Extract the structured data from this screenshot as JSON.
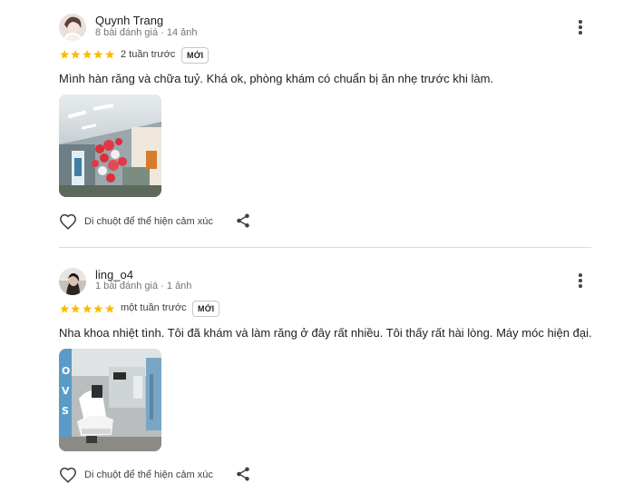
{
  "reviews": [
    {
      "name": "Quynh Trang",
      "meta": "8 bài đánh giá · 14 ảnh",
      "rating": 5,
      "time": "2 tuần trước",
      "badge": "MỚI",
      "text": "Mình hàn răng và chữa tuỷ. Khá ok, phòng khám có chuẩn bị ăn nhẹ trước khi làm.",
      "like_label": "Di chuột để thể hiện cảm xúc",
      "photo_icon": "clinic-interior-photo",
      "avatar_icon": "user-avatar-photo"
    },
    {
      "name": "ling_o4",
      "meta": "1 bài đánh giá · 1 ảnh",
      "rating": 5,
      "time": "một tuần trước",
      "badge": "MỚI",
      "text": "Nha khoa nhiệt tình. Tôi đã khám và làm răng ở đây rất nhiều. Tôi thấy rất hài lòng. Máy móc hiện đại.",
      "like_label": "Di chuột để thể hiện cảm xúc",
      "photo_icon": "dental-room-photo",
      "avatar_icon": "user-avatar-photo"
    }
  ],
  "colors": {
    "star": "#fbbc04",
    "divider": "#dadce0",
    "meta": "#70757a"
  }
}
